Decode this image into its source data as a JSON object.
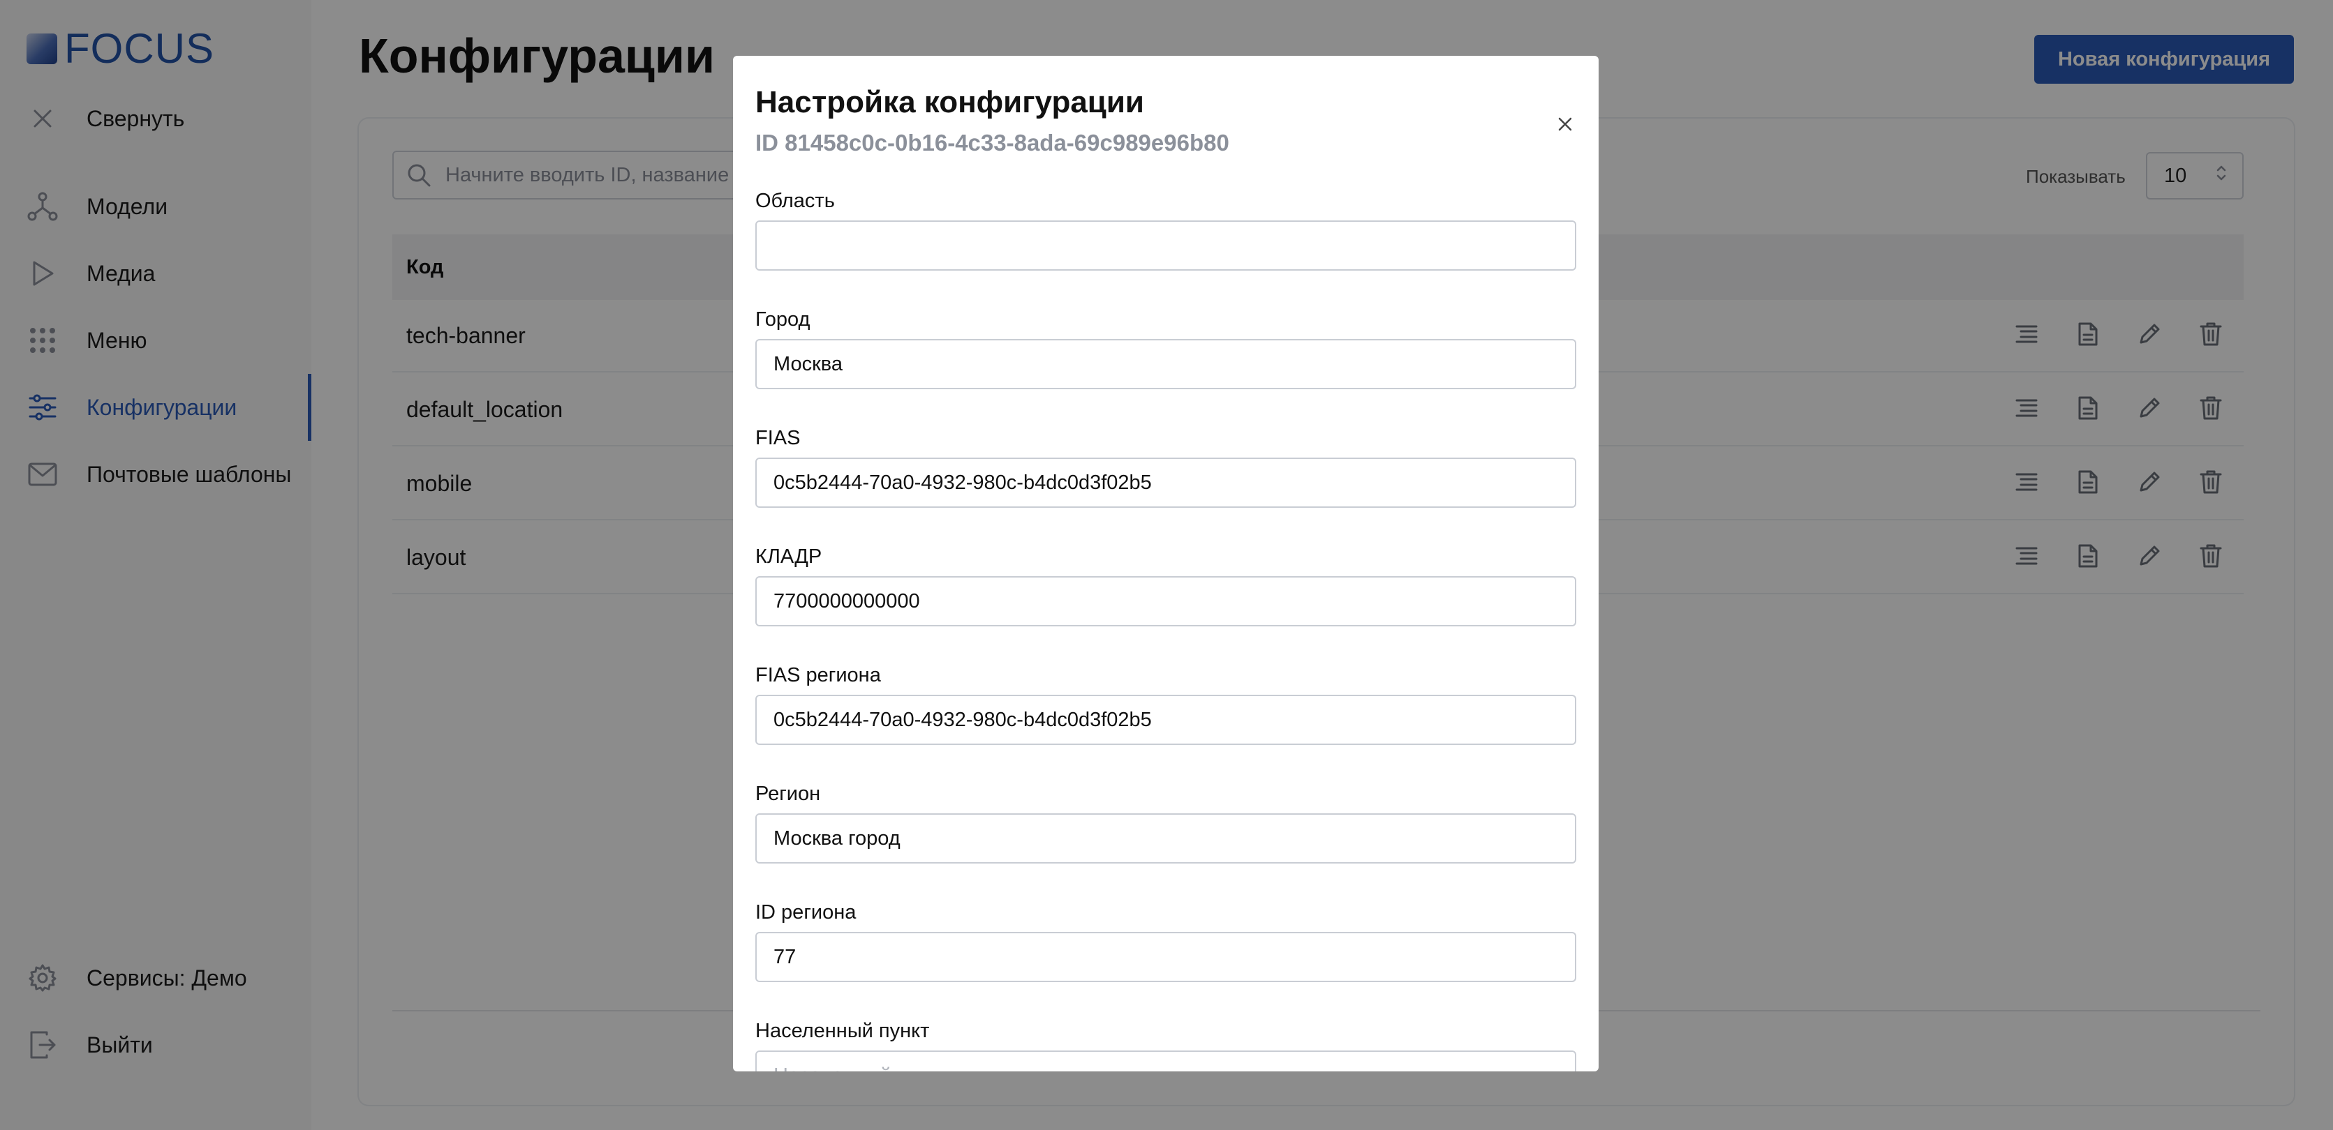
{
  "app": {
    "logo_text": "FOCUS"
  },
  "sidebar": {
    "items": [
      {
        "label": "Свернуть",
        "icon": "close-icon"
      },
      {
        "label": "Модели",
        "icon": "models-icon"
      },
      {
        "label": "Медиа",
        "icon": "play-icon"
      },
      {
        "label": "Меню",
        "icon": "grid-dots-icon"
      },
      {
        "label": "Конфигурации",
        "icon": "sliders-icon",
        "active": true
      },
      {
        "label": "Почтовые шаблоны",
        "icon": "mail-icon"
      }
    ],
    "bottom": [
      {
        "label": "Сервисы: Демо",
        "icon": "gear-icon"
      },
      {
        "label": "Выйти",
        "icon": "logout-icon"
      }
    ]
  },
  "header": {
    "title": "Конфигурации",
    "new_button": "Новая конфигурация"
  },
  "toolbar": {
    "search_placeholder": "Начните вводить ID, название",
    "show_label": "Показывать",
    "per_page": "10"
  },
  "table": {
    "columns": [
      "Код"
    ],
    "rows": [
      {
        "code": "tech-banner"
      },
      {
        "code": "default_location"
      },
      {
        "code": "mobile"
      },
      {
        "code": "layout"
      }
    ]
  },
  "modal": {
    "title": "Настройка конфигурации",
    "subtitle": "ID 81458c0c-0b16-4c33-8ada-69c989e96b80",
    "fields": [
      {
        "label": "Область",
        "value": "",
        "placeholder": ""
      },
      {
        "label": "Город",
        "value": "Москва",
        "placeholder": ""
      },
      {
        "label": "FIAS",
        "value": "0c5b2444-70a0-4932-980c-b4dc0d3f02b5",
        "placeholder": ""
      },
      {
        "label": "КЛАДР",
        "value": "7700000000000",
        "placeholder": ""
      },
      {
        "label": "FIAS региона",
        "value": "0c5b2444-70a0-4932-980c-b4dc0d3f02b5",
        "placeholder": ""
      },
      {
        "label": "Регион",
        "value": "Москва город",
        "placeholder": ""
      },
      {
        "label": "ID региона",
        "value": "77",
        "placeholder": ""
      },
      {
        "label": "Населенный пункт",
        "value": "",
        "placeholder": "Населенный пункт"
      }
    ]
  },
  "colors": {
    "accent": "#2a5ab6",
    "overlay": "rgba(0,0,0,0.45)",
    "sidebar_bg": "#f7f7f8",
    "muted_text": "#8b909a"
  }
}
